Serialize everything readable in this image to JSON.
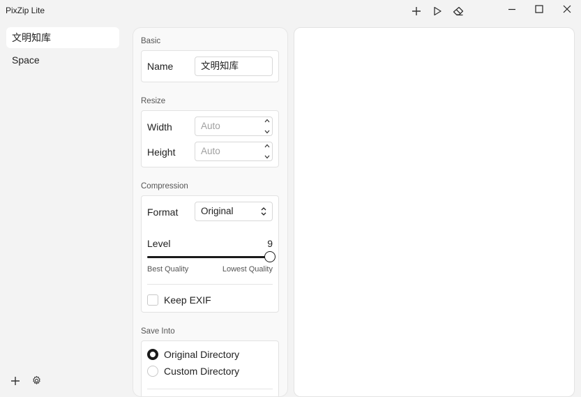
{
  "app": {
    "title": "PixZip Lite"
  },
  "toolbar": {
    "icons": [
      "plus-icon",
      "play-icon",
      "eraser-icon"
    ]
  },
  "window_controls": [
    "minimize-icon",
    "maximize-icon",
    "close-icon"
  ],
  "sidebar": {
    "items": [
      {
        "label": "文明知库",
        "active": true
      },
      {
        "label": "Space",
        "active": false
      }
    ],
    "bottom_icons": [
      "plus-icon",
      "gear-icon"
    ]
  },
  "settings": {
    "basic": {
      "section_label": "Basic",
      "name_label": "Name",
      "name_value": "文明知库"
    },
    "resize": {
      "section_label": "Resize",
      "width_label": "Width",
      "width_placeholder": "Auto",
      "height_label": "Height",
      "height_placeholder": "Auto"
    },
    "compression": {
      "section_label": "Compression",
      "format_label": "Format",
      "format_value": "Original",
      "level_label": "Level",
      "level_value": "9",
      "level_fraction": 1.0,
      "min_note": "Best Quality",
      "max_note": "Lowest Quality",
      "keep_exif_label": "Keep EXIF",
      "keep_exif_checked": false
    },
    "save_into": {
      "section_label": "Save Into",
      "options": [
        {
          "label": "Original Directory",
          "checked": true
        },
        {
          "label": "Custom Directory",
          "checked": false
        }
      ]
    }
  },
  "colors": {
    "background": "#f3f3f3",
    "accent": "#1a1a1a",
    "panel": "#ffffff"
  }
}
